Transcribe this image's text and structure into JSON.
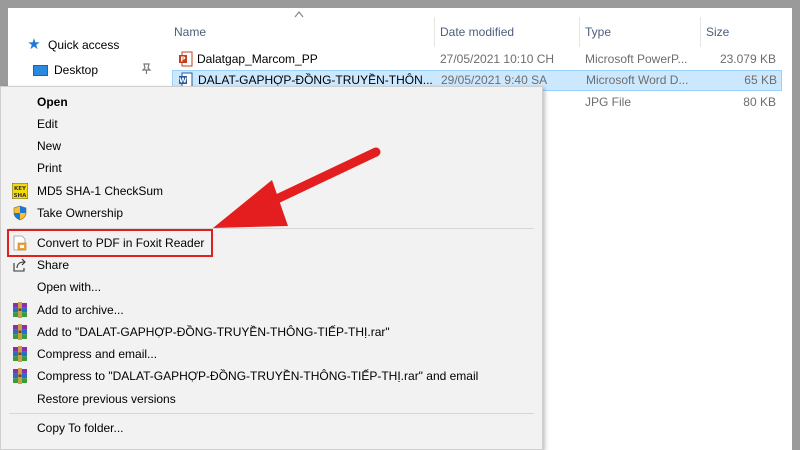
{
  "nav": {
    "quick_access": "Quick access",
    "desktop": "Desktop"
  },
  "columns": {
    "name": "Name",
    "date": "Date modified",
    "type": "Type",
    "size": "Size"
  },
  "files": [
    {
      "name": "Dalatgap_Marcom_PP",
      "date": "27/05/2021 10:10 CH",
      "type": "Microsoft PowerP...",
      "size": "23.079 KB",
      "icon": "powerpoint-icon"
    },
    {
      "name": "DALAT-GAPHỢP-ĐỒNG-TRUYỀN-THÔN...",
      "date": "29/05/2021 9:40 SA",
      "type": "Microsoft Word D...",
      "size": "65 KB",
      "icon": "word-icon"
    },
    {
      "name": "",
      "date": "",
      "type": "JPG File",
      "size": "80 KB",
      "icon": "image-icon"
    }
  ],
  "menu": {
    "open": "Open",
    "edit": "Edit",
    "new": "New",
    "print": "Print",
    "md5": "MD5 SHA-1 CheckSum",
    "take_ownership": "Take Ownership",
    "convert_pdf": "Convert to PDF in Foxit Reader",
    "share": "Share",
    "open_with": "Open with...",
    "add_archive": "Add to archive...",
    "add_rar": "Add to \"DALAT-GAPHỢP-ĐỒNG-TRUYỀN-THÔNG-TIẾP-THỊ.rar\"",
    "compress_email": "Compress and email...",
    "compress_rar_email": "Compress to \"DALAT-GAPHỢP-ĐỒNG-TRUYỀN-THÔNG-TIẾP-THỊ.rar\" and email",
    "restore": "Restore previous versions",
    "copy_to": "Copy To folder...",
    "md5_badge_top": "KEY",
    "md5_badge_bottom": "SHA"
  },
  "colors": {
    "accent": "#1e78d7",
    "selection": "#cce8ff",
    "highlight_red": "#e02020"
  }
}
